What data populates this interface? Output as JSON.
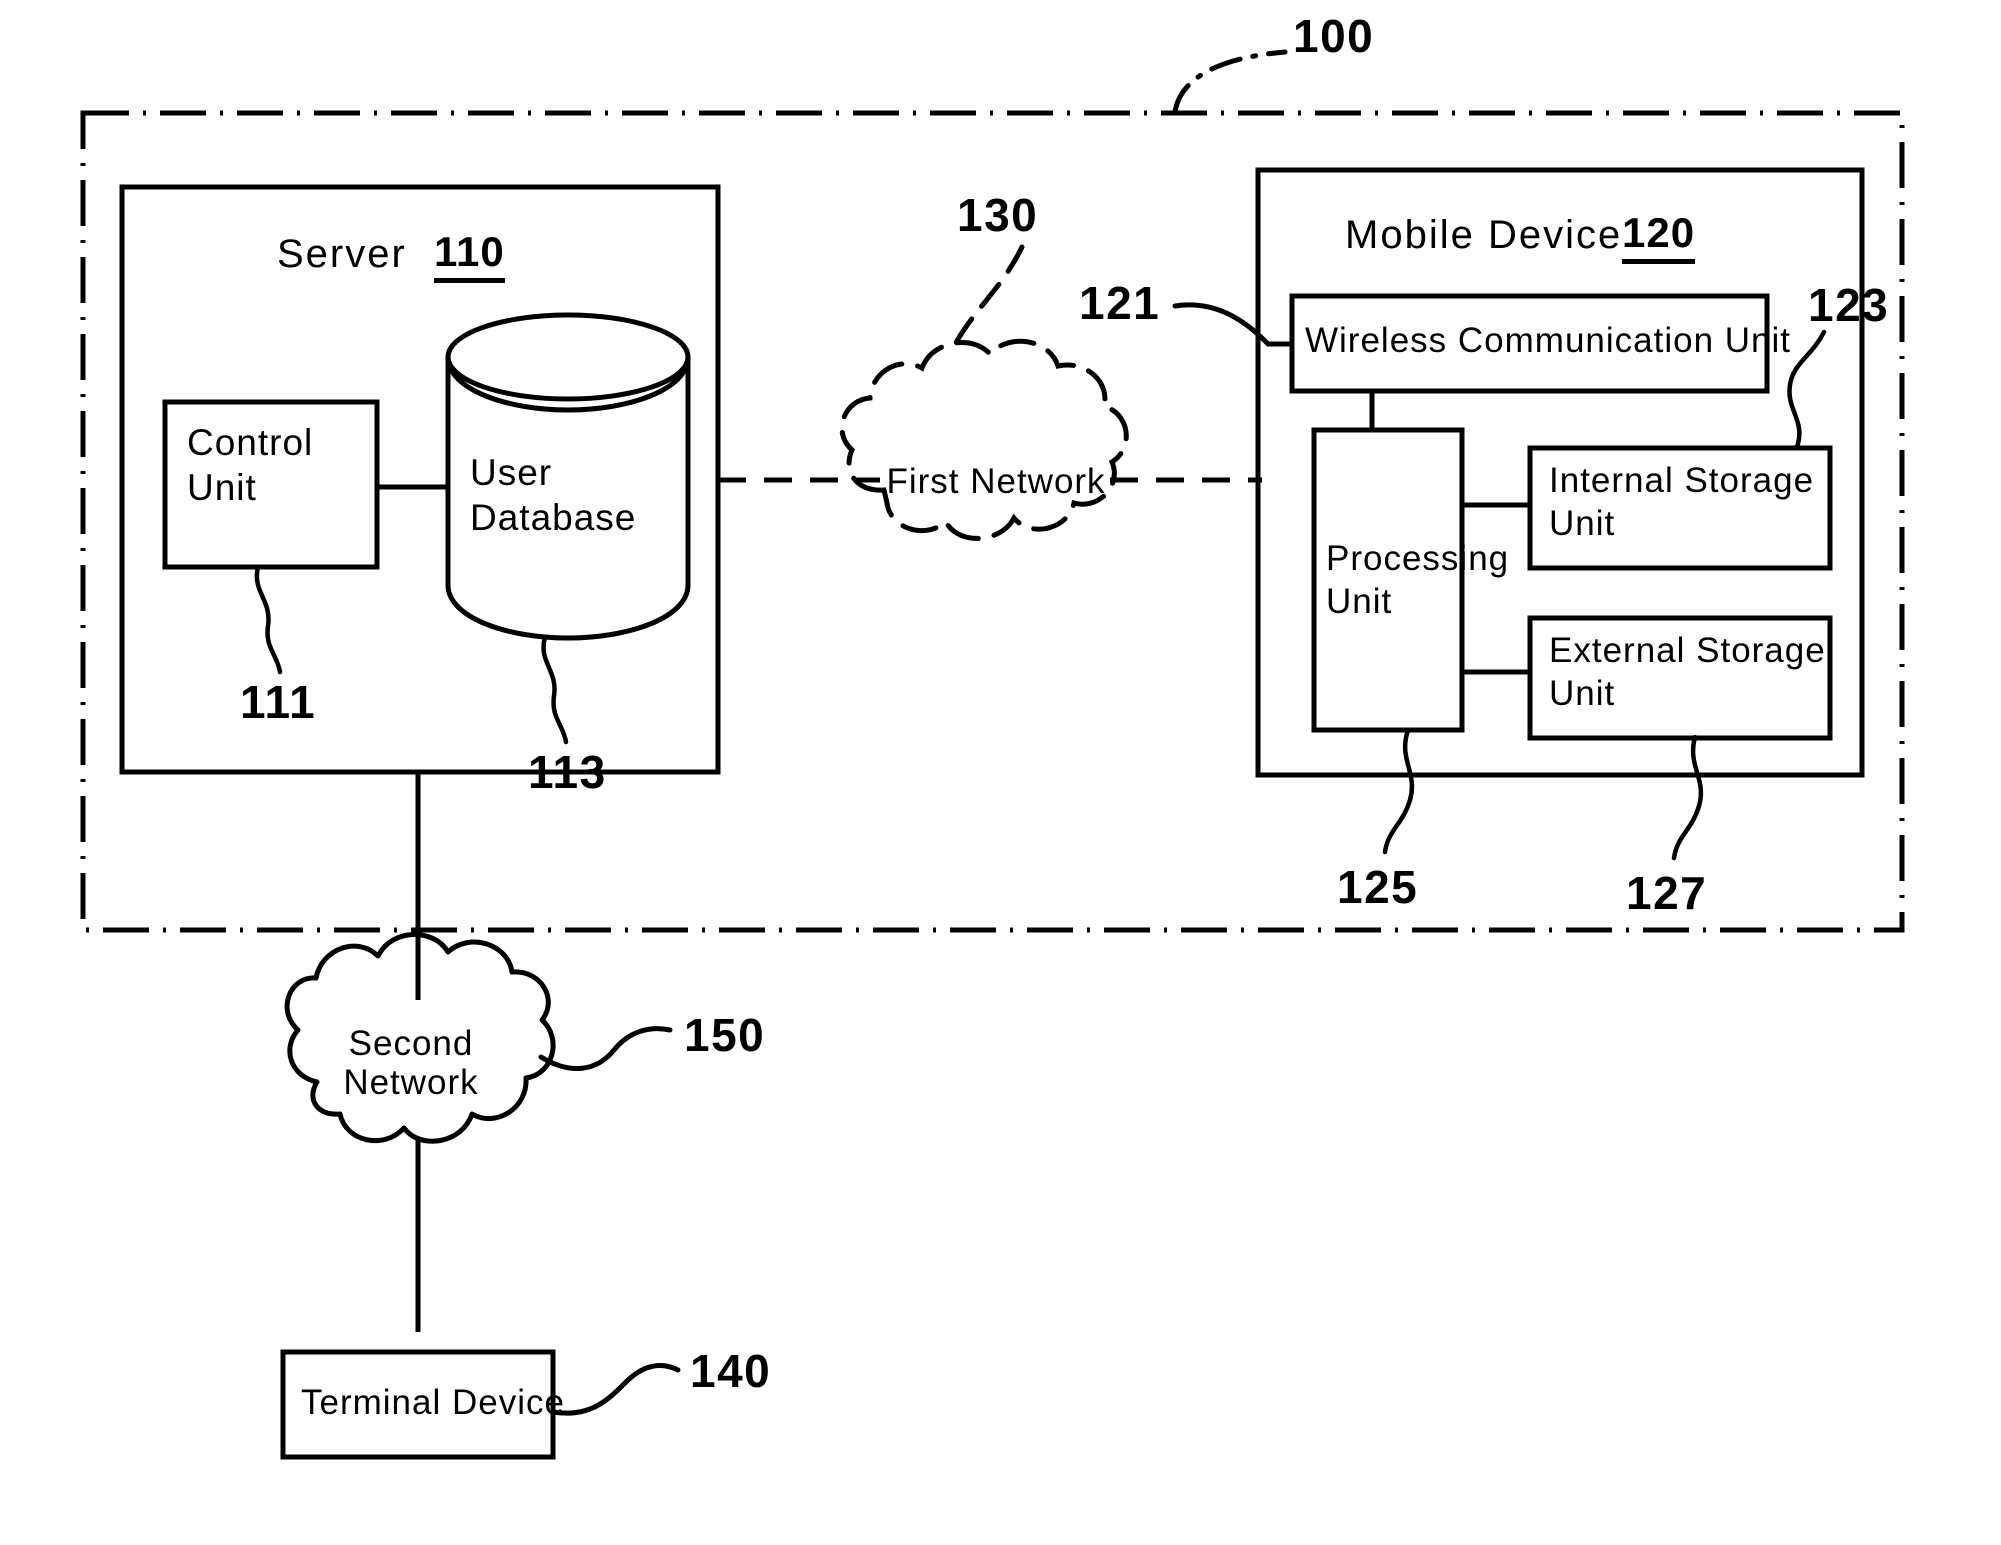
{
  "figure": {
    "system_ref": "100",
    "boundary_style": "dash-dot"
  },
  "server": {
    "title": "Server",
    "ref": "110",
    "control_unit": {
      "line1": "Control",
      "line2": "Unit",
      "ref": "111"
    },
    "user_database": {
      "line1": "User",
      "line2": "Database",
      "ref": "113"
    }
  },
  "first_network": {
    "line1": "First  Network",
    "ref": "130"
  },
  "mobile_device": {
    "title": "Mobile  Device",
    "ref": "120",
    "wireless_communication_unit": {
      "label": "Wireless Communication Unit",
      "ref": "121"
    },
    "processing_unit": {
      "line1": "Processing",
      "line2": "Unit",
      "ref": "125"
    },
    "internal_storage_unit": {
      "line1": "Internal  Storage",
      "line2": "Unit",
      "ref": "123"
    },
    "external_storage_unit": {
      "line1": "External  Storage",
      "line2": "Unit",
      "ref": "127"
    }
  },
  "second_network": {
    "line1": "Second",
    "line2": "Network",
    "ref": "150"
  },
  "terminal_device": {
    "label": "Terminal  Device",
    "ref": "140"
  },
  "colors": {
    "ink": "#000000",
    "paper": "#ffffff"
  }
}
